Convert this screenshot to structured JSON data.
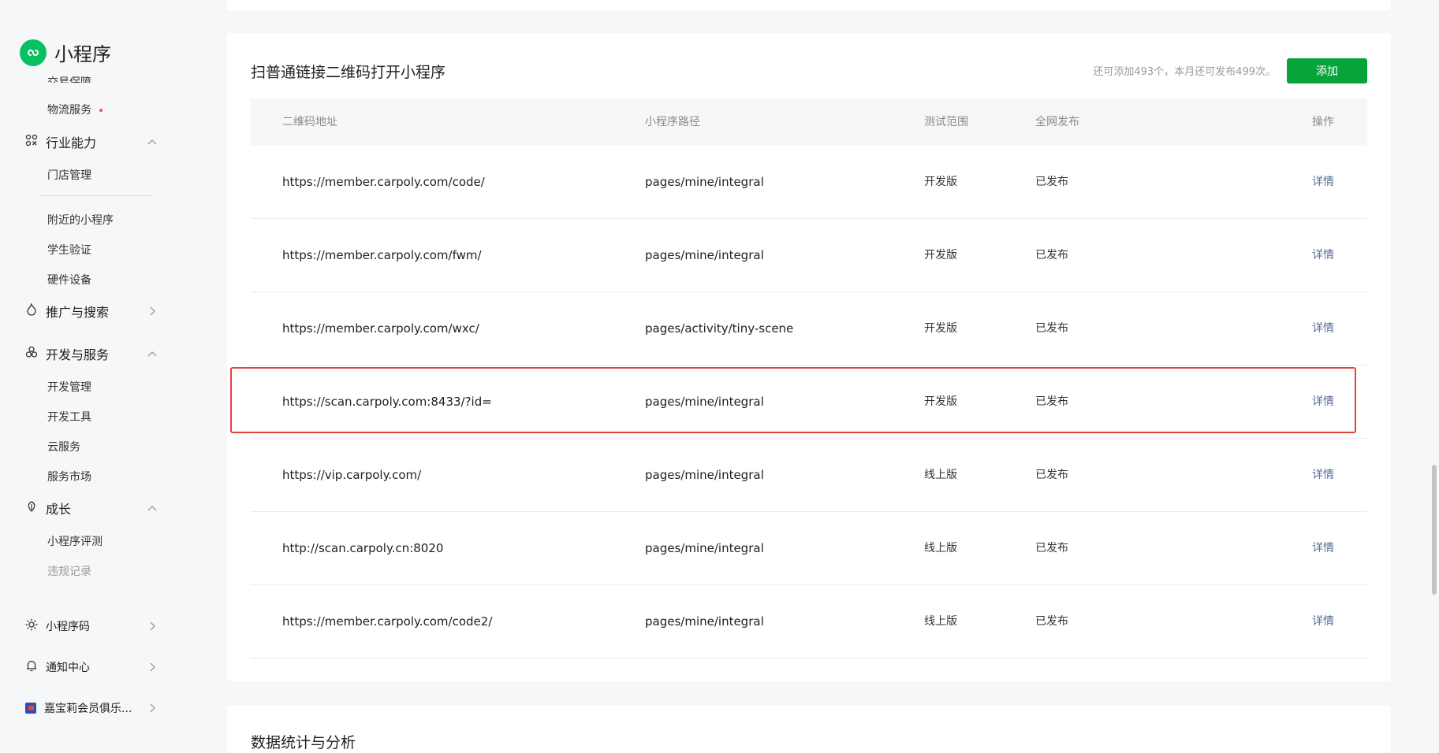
{
  "app": {
    "name": "小程序",
    "brand_color": "#07c160"
  },
  "sidebar": {
    "cut_item": "交易保障",
    "logistics": "物流服务",
    "industry": {
      "label": "行业能力",
      "items": [
        "门店管理"
      ]
    },
    "industry_more": [
      "附近的小程序",
      "学生验证",
      "硬件设备"
    ],
    "promotion": {
      "label": "推广与搜索"
    },
    "dev": {
      "label": "开发与服务",
      "items": [
        "开发管理",
        "开发工具",
        "云服务",
        "服务市场"
      ]
    },
    "growth": {
      "label": "成长",
      "items": [
        "小程序评测",
        "违规记录"
      ]
    },
    "qrcode": {
      "label": "小程序码"
    },
    "notify": {
      "label": "通知中心"
    },
    "account": {
      "label": "嘉宝莉会员俱乐..."
    }
  },
  "section": {
    "title": "扫普通链接二维码打开小程序",
    "quota": "还可添加493个，本月还可发布499次。",
    "add_label": "添加",
    "add_color": "#07a33b"
  },
  "table": {
    "headers": {
      "url": "二维码地址",
      "path": "小程序路径",
      "scope": "测试范围",
      "publish": "全网发布",
      "action": "操作"
    },
    "rows": [
      {
        "url": "https://member.carpoly.com/code/",
        "path": "pages/mine/integral",
        "scope": "开发版",
        "publish": "已发布",
        "action": "详情"
      },
      {
        "url": "https://member.carpoly.com/fwm/",
        "path": "pages/mine/integral",
        "scope": "开发版",
        "publish": "已发布",
        "action": "详情"
      },
      {
        "url": "https://member.carpoly.com/wxc/",
        "path": "pages/activity/tiny-scene",
        "scope": "开发版",
        "publish": "已发布",
        "action": "详情"
      },
      {
        "url": "https://scan.carpoly.com:8433/?id=",
        "path": "pages/mine/integral",
        "scope": "开发版",
        "publish": "已发布",
        "action": "详情"
      },
      {
        "url": "https://vip.carpoly.com/",
        "path": "pages/mine/integral",
        "scope": "线上版",
        "publish": "已发布",
        "action": "详情"
      },
      {
        "url": "http://scan.carpoly.cn:8020",
        "path": "pages/mine/integral",
        "scope": "线上版",
        "publish": "已发布",
        "action": "详情"
      },
      {
        "url": "https://member.carpoly.com/code2/",
        "path": "pages/mine/integral",
        "scope": "线上版",
        "publish": "已发布",
        "action": "详情"
      }
    ],
    "highlighted_row": 3,
    "highlight_color": "#e5413a"
  },
  "next_section": {
    "title": "数据统计与分析"
  }
}
